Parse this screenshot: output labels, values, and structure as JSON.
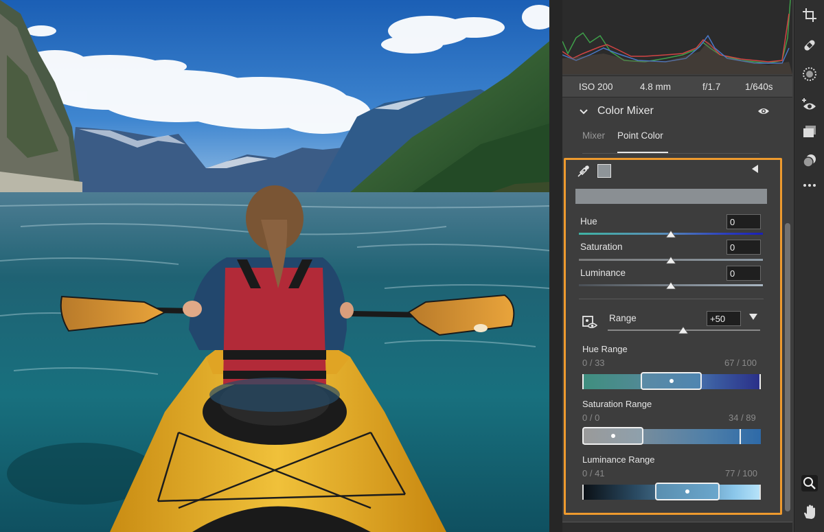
{
  "exif": {
    "iso": "ISO 200",
    "focal": "4.8 mm",
    "aperture": "f/1.7",
    "shutter": "1/640s"
  },
  "section": {
    "title": "Color Mixer"
  },
  "tabs": {
    "mixer": "Mixer",
    "point": "Point Color"
  },
  "point_color": {
    "sample_color": "#8a8f93",
    "hue": {
      "label": "Hue",
      "value": "0"
    },
    "saturation": {
      "label": "Saturation",
      "value": "0"
    },
    "luminance": {
      "label": "Luminance",
      "value": "0"
    },
    "range": {
      "label": "Range",
      "value": "+50"
    },
    "hue_range": {
      "label": "Hue Range",
      "left": "0 / 33",
      "right": "67 / 100"
    },
    "saturation_range": {
      "label": "Saturation Range",
      "left": "0 / 0",
      "right": "34 / 89"
    },
    "luminance_range": {
      "label": "Luminance Range",
      "left": "0 / 41",
      "right": "77 / 100"
    }
  },
  "colors": {
    "panel_bg": "#3d3d3d",
    "highlight": "#ee9a2e"
  },
  "tools": [
    "crop-icon",
    "healing-icon",
    "masking-icon",
    "redeye-icon",
    "presets-icon",
    "snapshot-icon",
    "more-icon",
    "zoom-icon",
    "hand-icon"
  ]
}
